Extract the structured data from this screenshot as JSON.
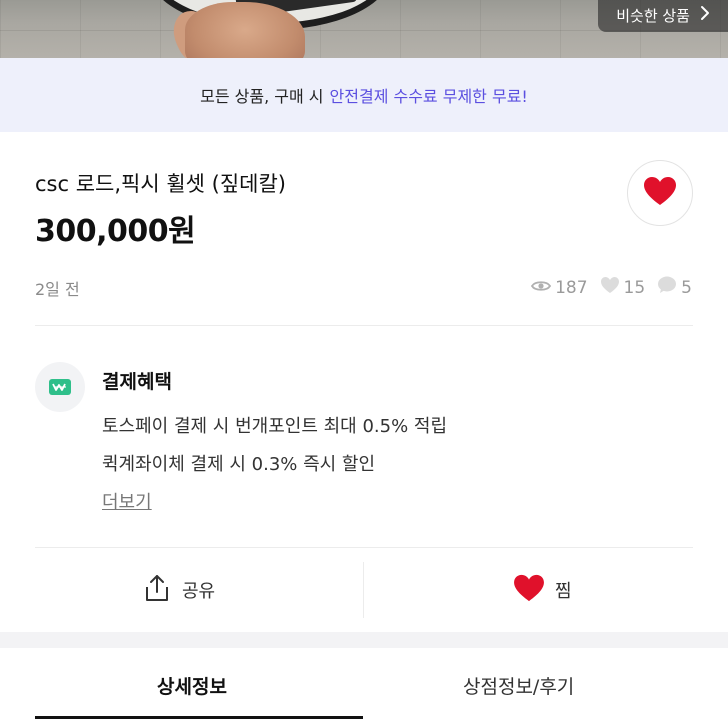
{
  "photo": {
    "similar_button": "비슷한 상품"
  },
  "banner": {
    "text": "모든 상품, 구매 시",
    "highlight": "안전결제 수수료 무제한 무료!"
  },
  "product": {
    "title": "csc 로드,픽시 휠셋 (짚데칼)",
    "price": "300,000원",
    "posted": "2일 전",
    "views": "187",
    "likes": "15",
    "chats": "5"
  },
  "benefits": {
    "title": "결제혜택",
    "line1": "토스페이 결제 시 번개포인트 최대 0.5% 적립",
    "line2": "퀵계좌이체 결제 시 0.3% 즉시 할인",
    "more": "더보기"
  },
  "actions": {
    "share": "공유",
    "jjim": "찜"
  },
  "tabs": {
    "detail": "상세정보",
    "shop": "상점정보/후기"
  },
  "colors": {
    "accent": "#5b4fe0",
    "heart": "#e0112b",
    "pay_badge": "#2fbf8a"
  }
}
